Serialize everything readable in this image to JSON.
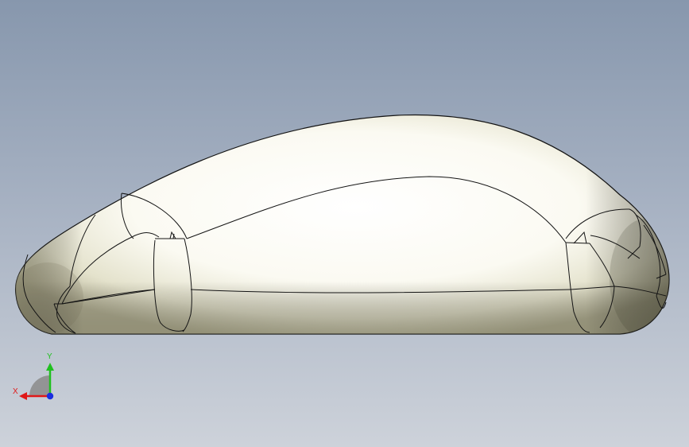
{
  "triad": {
    "x_label": "X",
    "y_label": "Y",
    "x_color": "#e01818",
    "y_color": "#20c020",
    "z_color": "#1a2ee0"
  },
  "model": {
    "description_icon": "mouse-shell-3d-model",
    "edge_color": "#141414",
    "body_color": "#f4f2e4"
  }
}
